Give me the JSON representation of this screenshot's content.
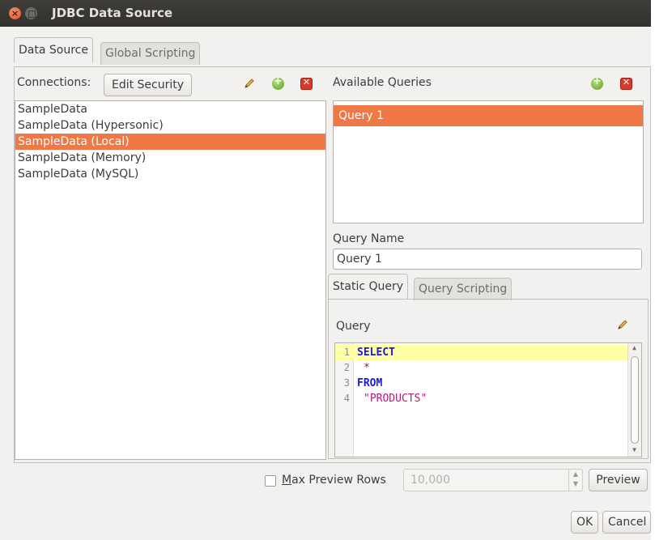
{
  "window": {
    "title": "JDBC Data Source",
    "close_glyph": "×"
  },
  "tabs": {
    "data_source": "Data Source",
    "global_scripting": "Global Scripting"
  },
  "connections": {
    "label": "Connections:",
    "edit_security": "Edit Security",
    "items": [
      "SampleData",
      "SampleData (Hypersonic)",
      "SampleData (Local)",
      "SampleData (Memory)",
      "SampleData (MySQL)"
    ],
    "selected_index": 2
  },
  "queries": {
    "label": "Available Queries",
    "items": [
      "Query 1"
    ],
    "selected_index": 0
  },
  "query_name": {
    "label": "Query Name",
    "value": "Query 1"
  },
  "query_tabs": {
    "static": "Static Query",
    "scripting": "Query Scripting"
  },
  "query_editor": {
    "label": "Query",
    "lines": [
      {
        "num": "1",
        "text": "SELECT"
      },
      {
        "num": "2",
        "text": "*"
      },
      {
        "num": "3",
        "text": "FROM"
      },
      {
        "num": "4",
        "text": "\"PRODUCTS\""
      }
    ]
  },
  "preview": {
    "max_rows_underlined": "M",
    "max_rows_rest": "ax Preview Rows",
    "max_rows_value": "10,000",
    "preview_label": "Preview"
  },
  "footer": {
    "ok": "OK",
    "cancel": "Cancel"
  },
  "colors": {
    "accent": "#f07746",
    "titlebar": "#3a3935",
    "background": "#f2f1f0"
  },
  "icons": [
    "close-icon",
    "minimize-icon",
    "pencil-icon",
    "add-icon",
    "delete-icon"
  ]
}
